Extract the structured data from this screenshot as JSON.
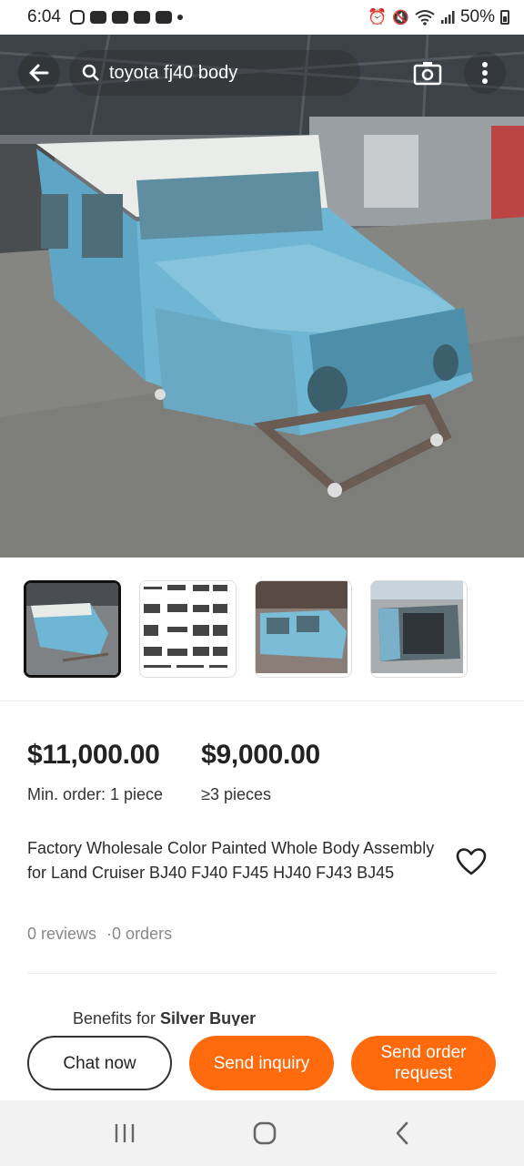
{
  "status_bar": {
    "time": "6:04",
    "battery": "50%",
    "notification_icons": [
      "instagram-icon",
      "youtube-icon",
      "youtube-icon",
      "youtube-icon",
      "youtube-icon"
    ],
    "system_icons": [
      "alarm-icon",
      "mute-icon",
      "wifi-icon",
      "signal-icon",
      "battery-icon"
    ]
  },
  "header": {
    "search_query": "toyota fj40 body",
    "icons": [
      "back-arrow-icon",
      "search-icon",
      "camera-search-icon",
      "more-vertical-icon"
    ]
  },
  "gallery": {
    "thumbnails": [
      {
        "name": "thumbnail-1",
        "selected": true
      },
      {
        "name": "thumbnail-2",
        "selected": false
      },
      {
        "name": "thumbnail-3",
        "selected": false
      },
      {
        "name": "thumbnail-4",
        "selected": false
      }
    ]
  },
  "pricing": {
    "tier1": {
      "price": "$11,000.00",
      "moq": "Min. order: 1 piece"
    },
    "tier2": {
      "price": "$9,000.00",
      "moq": "≥3 pieces"
    }
  },
  "product": {
    "title": "Factory Wholesale Color Painted Whole Body Assembly for  Land Cruiser BJ40 FJ40 FJ45 HJ40 FJ43 BJ45",
    "reviews": "0 reviews",
    "orders": "·0 orders"
  },
  "benefits": {
    "prefix": "Benefits for ",
    "tier": "Silver Buyer"
  },
  "actions": {
    "chat": "Chat now",
    "inquiry": "Send inquiry",
    "order": "Send order request"
  },
  "colors": {
    "accent": "#ff6a0c",
    "body_blue": "#6fb0cc"
  }
}
